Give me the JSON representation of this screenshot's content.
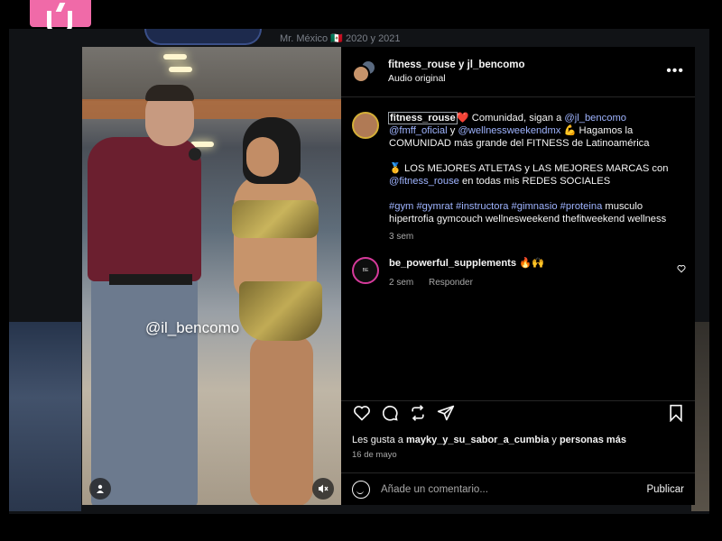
{
  "background": {
    "caption": "Mr. México 🇲🇽 2020 y 2021"
  },
  "colors": {
    "accent_pink": "#f06aa8",
    "link_blue": "#9fb4ff",
    "panel_bg": "#000000",
    "muted_text": "#a8a8a8"
  },
  "media": {
    "watermark": "@il_bencomo",
    "buttons": {
      "tagged_users_icon": "person-icon",
      "mute_icon": "speaker-muted-icon"
    }
  },
  "header": {
    "usernames": "fitness_rouse y jl_bencomo",
    "audio": "Audio original",
    "more_icon": "more-horizontal-icon"
  },
  "caption": {
    "username": "fitness_rouse",
    "line1_after_user": "❤️ Comunidad, sigan a",
    "mention1": "@jl_bencomo",
    "mention2": "@fmff_oficial",
    "conj": "y",
    "mention3": "@wellnessweekendmx",
    "line1_rest": "💪 Hagamos la COMUNIDAD más grande del FITNESS de Latinoamérica",
    "para2_text": "🥇 LOS MEJORES ATLETAS y LAS MEJORES MARCAS con",
    "para2_mention": "@fitness_rouse",
    "para2_rest": "en todas mis REDES SOCIALES",
    "hashtags": "#gym #gymrat #instructora #gimnasio #proteina",
    "hashtags_rest": "musculo hipertrofia gymcouch wellnesweekend thefitweekend wellness",
    "time": "3 sem"
  },
  "comment": {
    "username": "be_powerful_supplements",
    "text": "🔥🙌",
    "time": "2 sem",
    "reply": "Responder",
    "like_icon": "heart-outline-icon"
  },
  "actions": {
    "like": "heart-icon",
    "comment": "comment-icon",
    "share": "repost-icon",
    "send": "send-icon",
    "save": "bookmark-icon"
  },
  "likes": {
    "prefix": "Les gusta a",
    "user": "mayky_y_su_sabor_a_cumbia",
    "suffix": "y personas más"
  },
  "date": "16 de mayo",
  "comment_box": {
    "placeholder": "Añade un comentario...",
    "publish": "Publicar"
  }
}
